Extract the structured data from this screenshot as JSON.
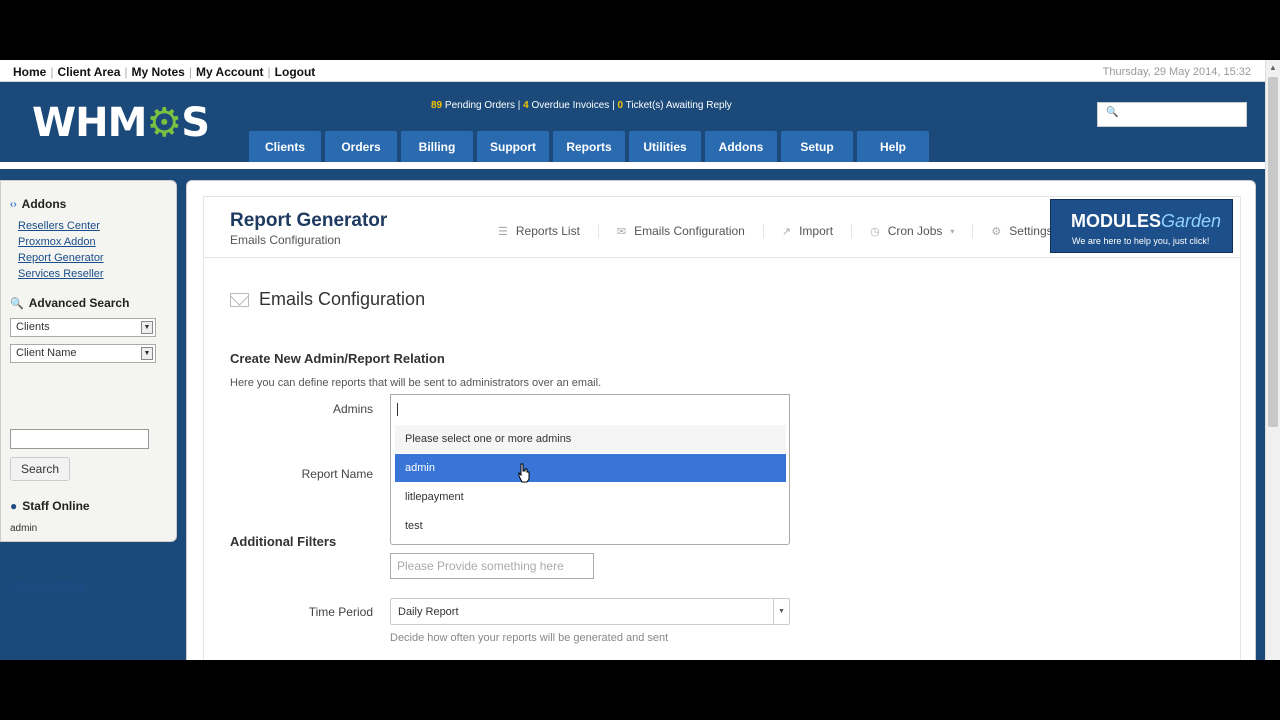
{
  "topbar": {
    "nav": [
      "Home",
      "Client Area",
      "My Notes",
      "My Account",
      "Logout"
    ],
    "datetime": "Thursday, 29 May 2014, 15:32"
  },
  "header": {
    "logo_text_1": "WHM",
    "logo_gear": "⚙",
    "logo_text_2": "S",
    "stats": {
      "pending_count": "89",
      "pending_label": "Pending Orders",
      "overdue_count": "4",
      "overdue_label": "Overdue Invoices",
      "tickets_count": "0",
      "tickets_label": "Ticket(s) Awaiting Reply",
      "sep": "|"
    },
    "search_icon": "search-icon",
    "nav": [
      "Clients",
      "Orders",
      "Billing",
      "Support",
      "Reports",
      "Utilities",
      "Addons",
      "Setup",
      "Help"
    ]
  },
  "sidebar": {
    "addons_title": "Addons",
    "addons_links": [
      "Resellers Center",
      "Proxmox Addon",
      "Report Generator",
      "Services Reseller"
    ],
    "advanced_search_title": "Advanced Search",
    "select1": "Clients",
    "select2": "Client Name",
    "search_button": "Search",
    "staff_online_title": "Staff Online",
    "staff_name": "admin",
    "minimise": "« Minimise Sidebar"
  },
  "module": {
    "title": "Report Generator",
    "subtitle": "Emails Configuration",
    "tabs": [
      "Reports List",
      "Emails Configuration",
      "Import",
      "Cron Jobs",
      "Settings"
    ],
    "banner_logo_a": "MODULES",
    "banner_logo_b": "Garden",
    "banner_tag": "We are here to help you, just click!"
  },
  "form": {
    "section_title": "Emails Configuration",
    "subheading": "Create New Admin/Report Relation",
    "help": "Here you can define reports that will be sent to administrators over an email.",
    "admins_label": "Admins",
    "report_name_label": "Report Name",
    "dropdown_hint": "Please select one or more admins",
    "dropdown_options": [
      "admin",
      "litlepayment",
      "test"
    ],
    "dropdown_active": "admin",
    "additional_filters": "Additional Filters",
    "filter_placeholder": "Please Provide something here",
    "time_period_label": "Time Period",
    "time_period_value": "Daily Report",
    "time_period_help": "Decide how often your reports will be generated and sent"
  },
  "colors": {
    "header_bg": "#1b4a7a",
    "nav_bg": "#2a6bb0",
    "active_option": "#3875d7",
    "stat_highlight": "#f5c400"
  }
}
